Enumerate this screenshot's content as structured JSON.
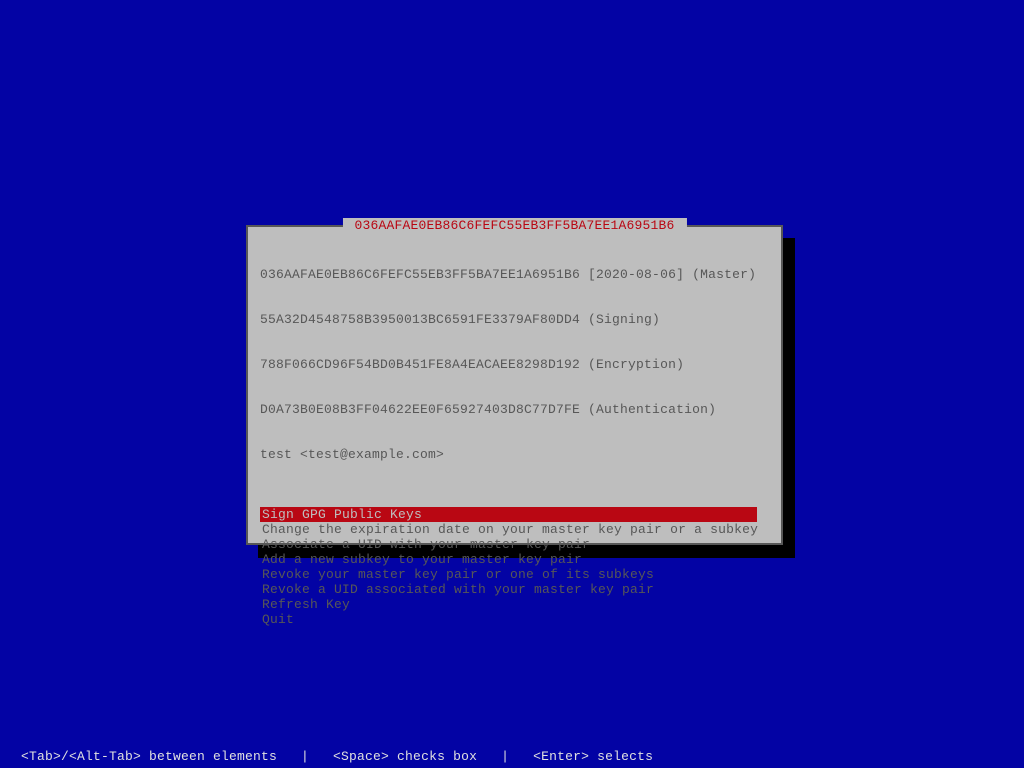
{
  "dialog": {
    "title": " 036AAFAE0EB86C6FEFC55EB3FF5BA7EE1A6951B6 ",
    "info_lines": [
      "036AAFAE0EB86C6FEFC55EB3FF5BA7EE1A6951B6 [2020-08-06] (Master)",
      "55A32D4548758B3950013BC6591FE3379AF80DD4 (Signing)",
      "788F066CD96F54BD0B451FE8A4EACAEE8298D192 (Encryption)",
      "D0A73B0E08B3FF04622EE0F65927403D8C77D7FE (Authentication)",
      "test <test@example.com>"
    ],
    "menu": [
      {
        "label": "Sign GPG Public Keys",
        "selected": true
      },
      {
        "label": "Change the expiration date on your master key pair or a subkey",
        "selected": false
      },
      {
        "label": "Associate a UID with your master key pair",
        "selected": false
      },
      {
        "label": "Add a new subkey to your master key pair",
        "selected": false
      },
      {
        "label": "Revoke your master key pair or one of its subkeys",
        "selected": false
      },
      {
        "label": "Revoke a UID associated with your master key pair",
        "selected": false
      },
      {
        "label": "Refresh Key",
        "selected": false
      },
      {
        "label": "Quit",
        "selected": false
      }
    ]
  },
  "footer": "<Tab>/<Alt-Tab> between elements   |   <Space> checks box   |   <Enter> selects"
}
